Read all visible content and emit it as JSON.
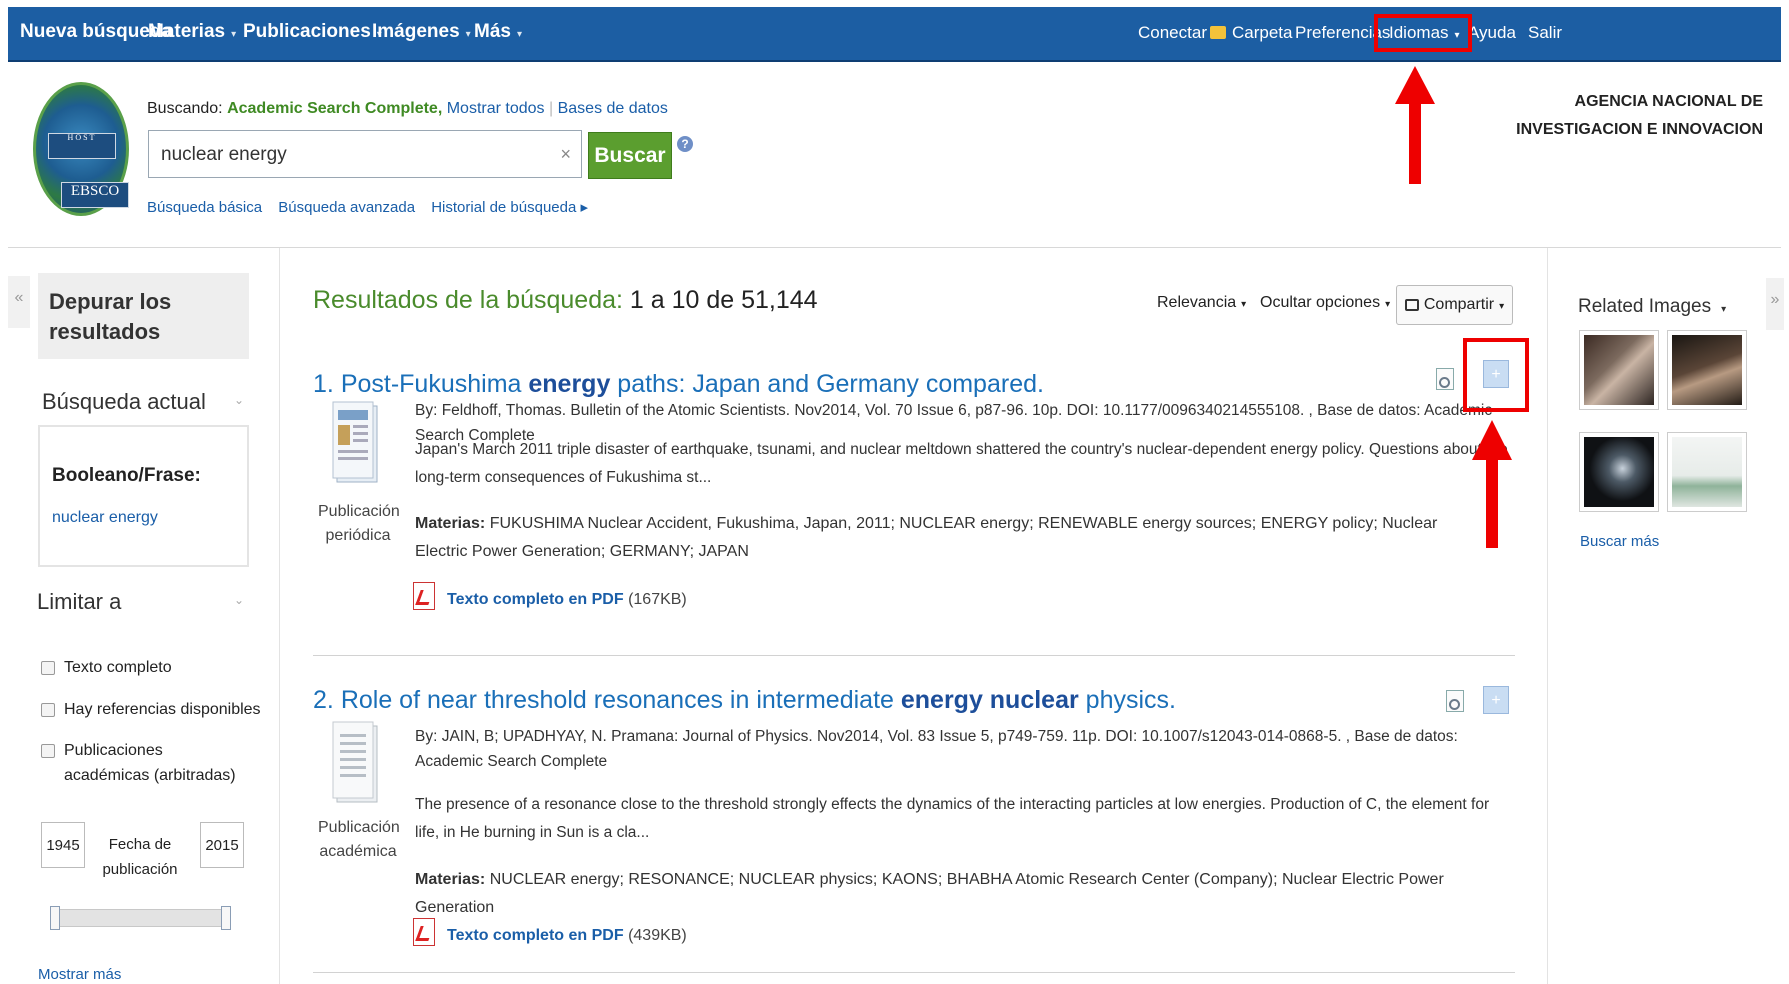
{
  "nav": {
    "left": [
      {
        "label": "Nueva búsqueda",
        "caret": ""
      },
      {
        "label": "Materias",
        "caret": "▾"
      },
      {
        "label": "Publicaciones",
        "caret": "▾"
      },
      {
        "label": "Imágenes",
        "caret": "▾"
      },
      {
        "label": "Más",
        "caret": "▾"
      }
    ],
    "right": [
      {
        "label": "Conectar"
      },
      {
        "label": "Carpeta"
      },
      {
        "label": "Preferencias"
      },
      {
        "label": "Idiomas",
        "caret": "▾"
      },
      {
        "label": "Ayuda"
      },
      {
        "label": "Salir"
      }
    ]
  },
  "header": {
    "logo_text": "EBSCO",
    "logo_sub": "HOST",
    "searching_label": "Buscando:",
    "database": "Academic Search Complete,",
    "show_all": "Mostrar todos",
    "databases_link": "Bases de datos",
    "query": "nuclear energy",
    "clear": "×",
    "search_button": "Buscar",
    "help": "?",
    "basic": "Búsqueda básica",
    "advanced": "Búsqueda avanzada",
    "history": "Historial de búsqueda ▸",
    "org_line1": "AGENCIA NACIONAL DE",
    "org_line2": "INVESTIGACION E INNOVACION"
  },
  "sidebar": {
    "collapse": "«",
    "refine_title": "Depurar los resultados",
    "current_search": "Búsqueda actual",
    "boolean_label": "Booleano/Frase:",
    "boolean_value": "nuclear energy",
    "limit_title": "Limitar a",
    "chevron": "⌄",
    "limits": [
      "Texto completo",
      "Hay referencias disponibles",
      "Publicaciones académicas (arbitradas)"
    ],
    "year_from": "1945",
    "year_to": "2015",
    "date_label": "Fecha de publicación",
    "show_more": "Mostrar más"
  },
  "results": {
    "heading": "Resultados de la búsqueda:",
    "count": "1 a 10 de 51,144",
    "sort": "Relevancia",
    "options": "Ocultar opciones",
    "share": "Compartir",
    "items": [
      {
        "num": "1.",
        "title_pre": "Post-Fukushima ",
        "title_b": "energy",
        "title_post": " paths: Japan and Germany compared.",
        "type": "Publicación periódica",
        "by": "By: Feldhoff, Thomas. Bulletin of the Atomic Scientists. Nov2014, Vol. 70 Issue 6, p87-96. 10p. DOI: 10.1177/0096340214555108. , Base de datos: Academic Search Complete",
        "abstract": "Japan's March 2011 triple disaster of earthquake, tsunami, and nuclear meltdown shattered the country's nuclear-dependent energy policy. Questions about the long-term consequences of Fukushima st...",
        "subjects_label": "Materias:",
        "subjects": "FUKUSHIMA Nuclear Accident, Fukushima, Japan, 2011; NUCLEAR energy; RENEWABLE energy sources; ENERGY policy; Nuclear Electric Power Generation; GERMANY; JAPAN",
        "pdf_link": "Texto completo en PDF",
        "pdf_size": "(167KB)"
      },
      {
        "num": "2.",
        "title_pre": "Role of near threshold resonances in intermediate ",
        "title_b": "energy nuclear",
        "title_post": " physics.",
        "type": "Publicación académica",
        "by": "By: JAIN, B; UPADHYAY, N. Pramana: Journal of Physics. Nov2014, Vol. 83 Issue 5, p749-759. 11p. DOI: 10.1007/s12043-014-0868-5. , Base de datos: Academic Search Complete",
        "abstract": "The presence of a resonance close to the threshold strongly effects the dynamics of the interacting particles at low energies. Production of C, the element for life, in He burning in Sun is a cla...",
        "subjects_label": "Materias:",
        "subjects": "NUCLEAR energy; RESONANCE; NUCLEAR physics; KAONS; BHABHA Atomic Research Center (Company); Nuclear Electric Power Generation",
        "pdf_link": "Texto completo en PDF",
        "pdf_size": "(439KB)"
      }
    ]
  },
  "right": {
    "related_images": "Related Images",
    "find_more": "Buscar más",
    "collapse": "»"
  },
  "colors": {
    "nav_bg": "#1c5ea3",
    "accent_green": "#4a8b2c",
    "link_blue": "#1a6fb8",
    "highlight_red": "#e00000"
  }
}
